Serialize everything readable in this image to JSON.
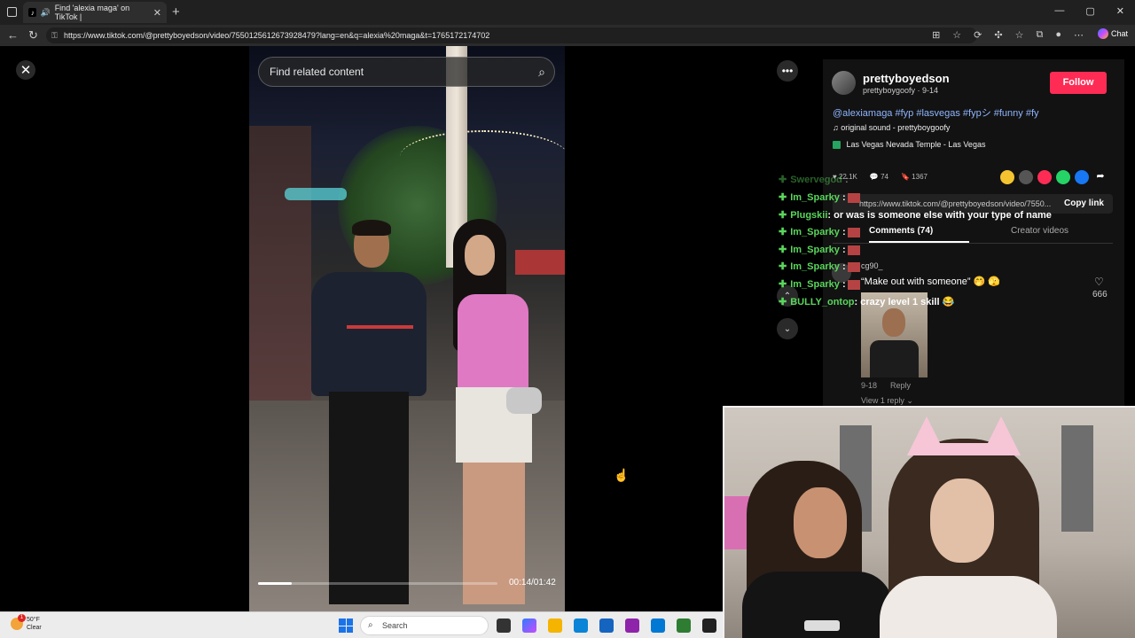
{
  "browser": {
    "tab_title": "Find 'alexia maga' on TikTok |",
    "tab_close": "✕",
    "new_tab": "+",
    "url": "https://www.tiktok.com/@prettyboyedson/video/7550125612673928479?lang=en&q=alexia%20maga&t=1765172174702",
    "chat_label": "Chat"
  },
  "viewer": {
    "search_placeholder": "Find related content",
    "timecode": "00:14/01:42",
    "progress_fraction": 0.14
  },
  "post": {
    "username": "prettyboyedson",
    "subline": "prettyboygoofy · 9-14",
    "follow_label": "Follow",
    "caption": "@alexiamaga #fyp #lasvegas #fypシ #funny #fy",
    "sound": "original sound - prettyboygoofy",
    "location": "Las Vegas Nevada Temple - Las Vegas",
    "likes": "22.1K",
    "comments": "74",
    "saves": "1367",
    "link": "https://www.tiktok.com/@prettyboyedson/video/7550...",
    "copy_label": "Copy link",
    "tab_comments": "Comments (74)",
    "tab_creator": "Creator videos"
  },
  "comment": {
    "user": "cg90_",
    "text": "“Make out with someone” 🤭 🫣",
    "date": "9-18",
    "reply": "Reply",
    "view_replies": "View 1 reply ⌄",
    "likes": "666"
  },
  "chat": [
    {
      "who": "Swervegod",
      "msg": ":"
    },
    {
      "who": "Im_Sparky",
      "msg": ":"
    },
    {
      "who": "Plugskii",
      "msg": ": or was is someone else with your type of name"
    },
    {
      "who": "Im_Sparky",
      "msg": ":"
    },
    {
      "who": "Im_Sparky",
      "msg": ":"
    },
    {
      "who": "Im_Sparky",
      "msg": ":"
    },
    {
      "who": "Im_Sparky",
      "msg": ":"
    },
    {
      "who": "BULLY_ontop",
      "msg": ": crazy level 1 skill 😂"
    }
  ],
  "taskbar": {
    "temp": "50°F",
    "condition": "Clear",
    "badge": "1",
    "search_label": "Search"
  },
  "colors": {
    "follow": "#fe2c55",
    "chat_name": "#59d65b",
    "caption_link": "#8fb5ff"
  }
}
